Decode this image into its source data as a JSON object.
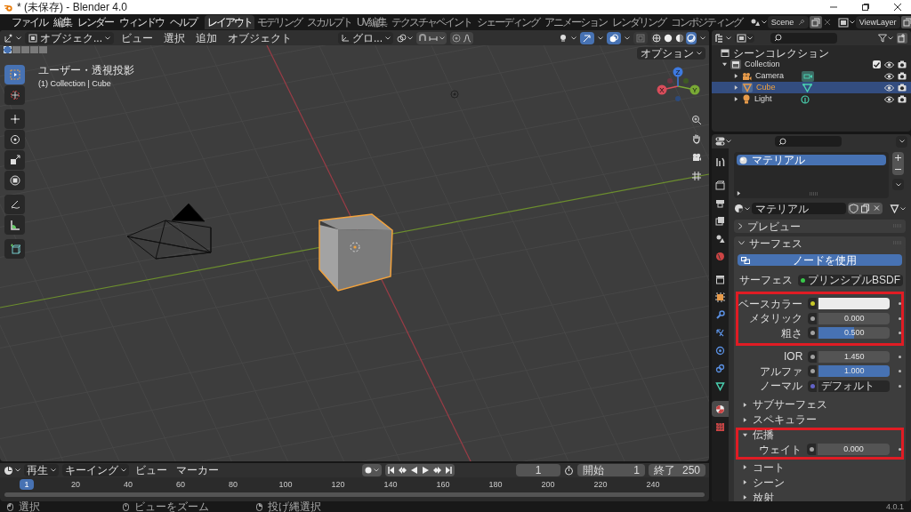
{
  "window": {
    "title": "* (未保存) - Blender 4.0"
  },
  "menu": [
    "ファイル",
    "編集",
    "レンダー",
    "ウィンドウ",
    "ヘルプ"
  ],
  "workspaces": [
    {
      "label": "レイアウト",
      "selected": true
    },
    {
      "label": "モデリング",
      "selected": false
    },
    {
      "label": "スカルプト",
      "selected": false
    },
    {
      "label": "UV編集",
      "selected": false
    },
    {
      "label": "テクスチャペイント",
      "selected": false
    },
    {
      "label": "シェーディング",
      "selected": false
    },
    {
      "label": "アニメーション",
      "selected": false
    },
    {
      "label": "レンダリング",
      "selected": false
    },
    {
      "label": "コンポジティング",
      "selected": false
    }
  ],
  "scene": "Scene",
  "view_layer": "ViewLayer",
  "viewport": {
    "mode": "オブジェク...",
    "menus": [
      "ビュー",
      "選択",
      "追加",
      "オブジェクト"
    ],
    "orientation": "グロ...",
    "options": "オプション",
    "view_name": "ユーザー・透視投影",
    "context": "(1) Collection | Cube",
    "select_modes": [
      {
        "selected": true
      },
      {
        "selected": false
      },
      {
        "selected": false
      },
      {
        "selected": false
      },
      {
        "selected": false
      }
    ],
    "snap_on": false,
    "proportional_on": false,
    "gizmo_on": true,
    "overlay_on": true,
    "xray_on": false,
    "shading": [
      {
        "kind": "wire",
        "selected": false
      },
      {
        "kind": "solid",
        "selected": false
      },
      {
        "kind": "material",
        "selected": false
      },
      {
        "kind": "rendered",
        "selected": true
      }
    ],
    "tool_groups": [
      [
        {
          "kind": "select",
          "selected": true
        },
        {
          "kind": "cursor",
          "selected": false
        }
      ],
      [
        {
          "kind": "move",
          "selected": false
        },
        {
          "kind": "rotate",
          "selected": false
        },
        {
          "kind": "scale",
          "selected": false
        },
        {
          "kind": "transform",
          "selected": false
        }
      ],
      [
        {
          "kind": "annotate",
          "selected": false
        },
        {
          "kind": "measure",
          "selected": false
        }
      ],
      [
        {
          "kind": "add_cube",
          "selected": false
        }
      ]
    ],
    "gizmo_axes": [
      "X",
      "Y",
      "Z"
    ],
    "nav_buttons": [
      {
        "kind": "zoom"
      },
      {
        "kind": "pan"
      },
      {
        "kind": "camera"
      },
      {
        "kind": "grid"
      }
    ]
  },
  "timeline": {
    "record_on": false,
    "play": "再生",
    "keying": "キーイング",
    "menus": [
      "ビュー",
      "マーカー"
    ],
    "current_frame": "1",
    "start_label": "開始",
    "start": "1",
    "end_label": "終了",
    "end": "250",
    "marker": "1",
    "ticks": [
      "20",
      "40",
      "60",
      "80",
      "100",
      "120",
      "140",
      "160",
      "180",
      "200",
      "220",
      "240"
    ]
  },
  "status_bar": {
    "hints": [
      {
        "kind": "left",
        "text": "選択"
      },
      {
        "kind": "middle",
        "text": "ビューをズーム"
      },
      {
        "kind": "right",
        "text": "投げ縄選択"
      }
    ],
    "version": "4.0.1"
  },
  "outliner": {
    "root": "シーンコレクション",
    "items": [
      {
        "label": "Collection",
        "kind": "collection",
        "selected": false,
        "expanded": true,
        "checked": true,
        "children": [
          {
            "label": "Camera",
            "kind": "camera",
            "selected": false,
            "expanded": false
          },
          {
            "label": "Cube",
            "kind": "mesh",
            "selected": true,
            "expanded": false
          },
          {
            "label": "Light",
            "kind": "light",
            "selected": false,
            "expanded": false
          }
        ]
      }
    ]
  },
  "properties": {
    "tabs": [
      {
        "kind": "tool",
        "selected": false
      },
      {
        "kind": "render",
        "selected": false
      },
      {
        "kind": "output",
        "selected": false
      },
      {
        "kind": "view_layer",
        "selected": false
      },
      {
        "kind": "scene",
        "selected": false
      },
      {
        "kind": "world",
        "selected": false
      },
      {
        "kind": "collection",
        "selected": false
      },
      {
        "kind": "object",
        "selected": false
      },
      {
        "kind": "modifier",
        "selected": false
      },
      {
        "kind": "particles",
        "selected": false
      },
      {
        "kind": "physics",
        "selected": false
      },
      {
        "kind": "constraints",
        "selected": false
      },
      {
        "kind": "data",
        "selected": false
      },
      {
        "kind": "material",
        "selected": true
      },
      {
        "kind": "texture",
        "selected": false
      }
    ],
    "slots": [
      {
        "label": "マテリアル",
        "selected": true
      }
    ],
    "material": "マテリアル",
    "preview": {
      "label": "プレビュー",
      "expanded": false
    },
    "surface": {
      "label": "サーフェス",
      "expanded": true,
      "use_nodes": "ノードを使用",
      "shader": {
        "label": "サーフェス",
        "value": "プリンシプルBSDF",
        "color": "#39c74a"
      },
      "groups": [
        {
          "highlighted": true,
          "rows": [
            {
              "kind": "color",
              "label": "ベースカラー",
              "color": "#c7c729",
              "swatch": {
                "color": "#ececec"
              }
            },
            {
              "kind": "slider",
              "label": "メタリック",
              "color": "#a1a1a1",
              "value": "0.000",
              "level": 0
            },
            {
              "kind": "slider",
              "label": "粗さ",
              "color": "#a1a1a1",
              "value": "0.500",
              "level": 0.5
            }
          ]
        },
        {
          "highlighted": false,
          "rows": [
            {
              "kind": "number",
              "label": "IOR",
              "color": "#a1a1a1",
              "value": "1.450"
            },
            {
              "kind": "slider",
              "label": "アルファ",
              "color": "#a1a1a1",
              "value": "1.000",
              "level": 1
            },
            {
              "kind": "link",
              "label": "ノーマル",
              "color": "#6363c7",
              "value": "デフォルト"
            }
          ]
        }
      ],
      "subpanels": [
        {
          "label": "サブサーフェス",
          "expanded": false,
          "highlighted": false
        },
        {
          "label": "スペキュラー",
          "expanded": false,
          "highlighted": false
        },
        {
          "label": "伝播",
          "expanded": true,
          "highlighted": true,
          "rows": [
            {
              "kind": "slider",
              "label": "ウェイト",
              "color": "#a1a1a1",
              "value": "0.000",
              "level": 0
            }
          ]
        },
        {
          "label": "コート",
          "expanded": false,
          "highlighted": false
        },
        {
          "label": "シーン",
          "expanded": false,
          "highlighted": false
        },
        {
          "label": "放射",
          "expanded": false,
          "highlighted": false
        }
      ]
    }
  }
}
